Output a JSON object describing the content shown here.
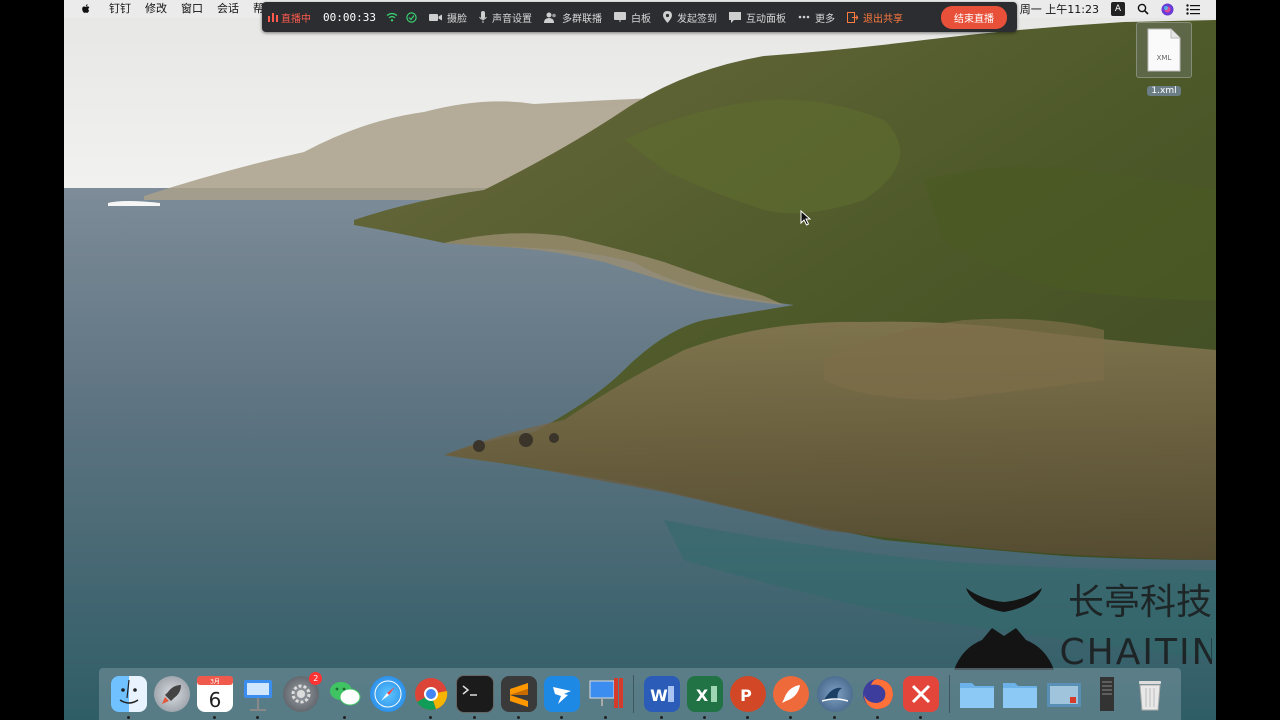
{
  "menubar": {
    "items": [
      "钉钉",
      "修改",
      "窗口",
      "会话",
      "帮"
    ],
    "clock": "周一 上午11:23",
    "input_method": "A"
  },
  "livebar": {
    "status": "直播中",
    "elapsed": "00:00:33",
    "items": [
      "摄脸",
      "声音设置",
      "多群联播",
      "白板",
      "发起签到",
      "互动面板",
      "更多"
    ],
    "exit_share": "退出共享",
    "end_live": "结束直播"
  },
  "desktop": {
    "file_name": "1.xml",
    "file_type": "XML"
  },
  "watermark": {
    "text_cn": "长亭科技",
    "text_en": "CHAITIN"
  },
  "dock": {
    "calendar_day": "6",
    "calendar_month": "3月",
    "system_prefs_badge": "2"
  },
  "colors": {
    "live_red": "#ff5a4d",
    "end_button": "#e8503a",
    "exit_orange": "#ff7a3d",
    "livebar_bg": "#2b2d31"
  }
}
